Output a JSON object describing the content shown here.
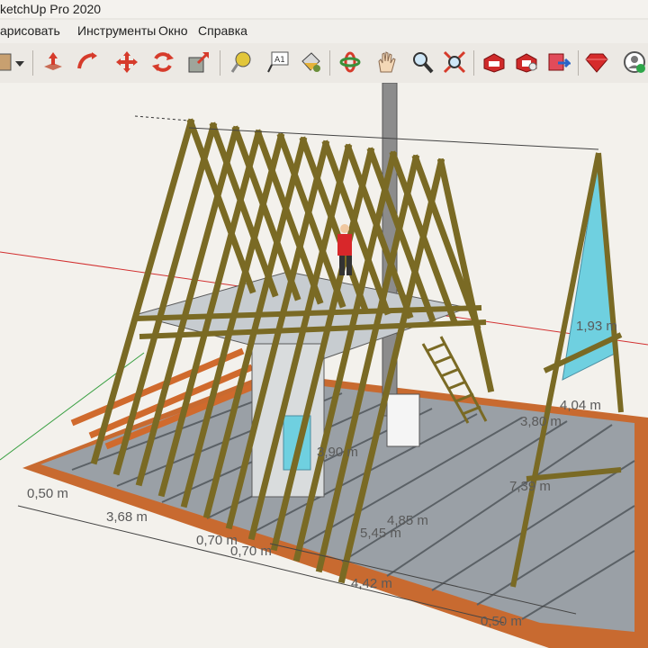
{
  "window": {
    "title": "ketchUp Pro 2020"
  },
  "menu": {
    "items": [
      "арисовать",
      "Инструменты",
      "Окно",
      "Справка"
    ]
  },
  "toolbar": {
    "tools": [
      "select-arrow-icon",
      "dropdown-icon",
      "push-pull-icon",
      "follow-me-icon",
      "move-icon",
      "rotate-icon",
      "scale-icon",
      "tape-measure-icon",
      "text-label-icon",
      "paint-bucket-icon",
      "orbit-icon",
      "pan-icon",
      "zoom-icon",
      "zoom-extents-icon",
      "warehouse-icon",
      "extension-warehouse-icon",
      "send-to-layout-icon",
      "ruby-console-icon",
      "account-icon"
    ],
    "text_tool_label": "A1"
  },
  "dimensions": {
    "d1": "0,50 m",
    "d2": "3,68 m",
    "d3": "0,70 m",
    "d4": "0,70 m",
    "d5": "4,42 m",
    "d6": "0,50 m",
    "d7": "4,85 m",
    "d8": "5,45 m",
    "d9": "4,04 m",
    "d10": "3,80 m",
    "d11": "1,93 m",
    "d12": "7,39 m",
    "d13": "3,90 m"
  },
  "colors": {
    "timber": "#7a6a24",
    "floor": "#9aa0a6",
    "deck": "#d57a3c",
    "glass": "#6fd0e0",
    "axis_red": "#d23030",
    "axis_green": "#3aa043"
  }
}
